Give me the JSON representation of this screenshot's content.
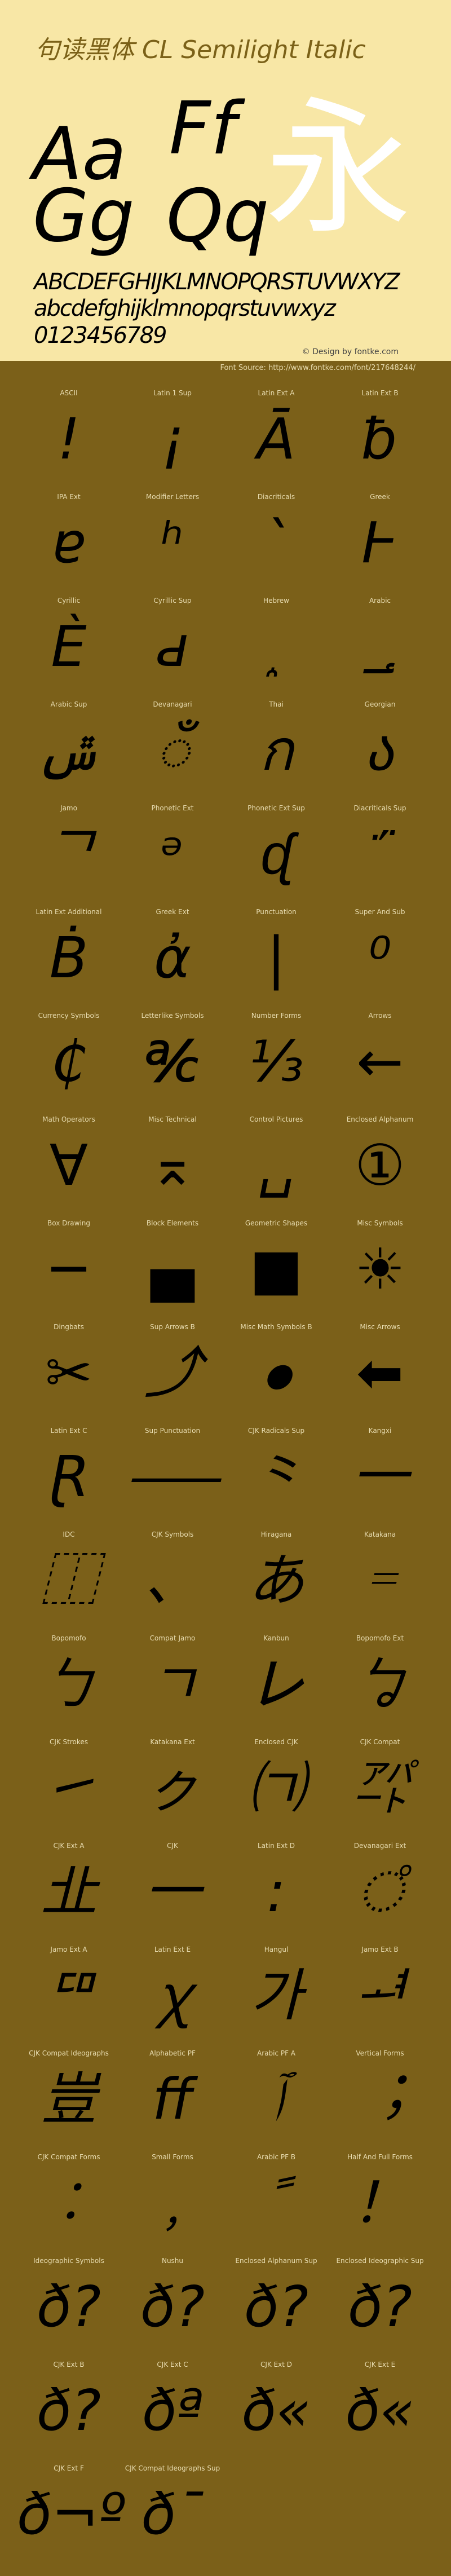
{
  "header": {
    "title": "句读黑体 CL Semilight Italic",
    "samples": [
      "Aa",
      "Ff",
      "Gg",
      "Qq"
    ],
    "hero": "永",
    "uppercase": "ABCDEFGHIJKLMNOPQRSTUVWXYZ",
    "lowercase": "abcdefghijklmnopqrstuvwxyz",
    "digits": "0123456789",
    "credit": "© Design by fontke.com",
    "source": "Font Source: http://www.fontke.com/font/217648244/"
  },
  "colors": {
    "header_bg": "#f8e7a6",
    "title": "#7b6118",
    "grid_bg": "#7b6019",
    "label": "#e8dcb0"
  },
  "blocks": [
    {
      "label": "ASCII",
      "glyph": "!"
    },
    {
      "label": "Latin 1 Sup",
      "glyph": "¡"
    },
    {
      "label": "Latin Ext A",
      "glyph": "Ā"
    },
    {
      "label": "Latin Ext B",
      "glyph": "ƀ"
    },
    {
      "label": "IPA Ext",
      "glyph": "ɐ"
    },
    {
      "label": "Modifier Letters",
      "glyph": "ʰ"
    },
    {
      "label": "Diacriticals",
      "glyph": "ˋ"
    },
    {
      "label": "Greek",
      "glyph": "Ͱ"
    },
    {
      "label": "Cyrillic",
      "glyph": "Ѐ"
    },
    {
      "label": "Cyrillic Sup",
      "glyph": "ԁ"
    },
    {
      "label": "Hebrew",
      "glyph": "֑"
    },
    {
      "label": "Arabic",
      "glyph": "؀"
    },
    {
      "label": "Arabic Sup",
      "glyph": "ݜ"
    },
    {
      "label": "Devanagari",
      "glyph": "ँ"
    },
    {
      "label": "Thai",
      "glyph": "ก"
    },
    {
      "label": "Georgian",
      "glyph": "ა"
    },
    {
      "label": "Jamo",
      "glyph": "ᄀ"
    },
    {
      "label": "Phonetic Ext",
      "glyph": "ᵊ"
    },
    {
      "label": "Phonetic Ext Sup",
      "glyph": "ᶑ"
    },
    {
      "label": "Diacriticals Sup",
      "glyph": "᷁"
    },
    {
      "label": "Latin Ext Additional",
      "glyph": "Ḃ"
    },
    {
      "label": "Greek Ext",
      "glyph": "ἀ"
    },
    {
      "label": "Punctuation",
      "glyph": "|"
    },
    {
      "label": "Super And Sub",
      "glyph": "⁰"
    },
    {
      "label": "Currency Symbols",
      "glyph": "₵"
    },
    {
      "label": "Letterlike Symbols",
      "glyph": "℀"
    },
    {
      "label": "Number Forms",
      "glyph": "⅓"
    },
    {
      "label": "Arrows",
      "glyph": "←"
    },
    {
      "label": "Math Operators",
      "glyph": "∀"
    },
    {
      "label": "Misc Technical",
      "glyph": "⌅"
    },
    {
      "label": "Control Pictures",
      "glyph": "␣"
    },
    {
      "label": "Enclosed Alphanum",
      "glyph": "①"
    },
    {
      "label": "Box Drawing",
      "glyph": "─"
    },
    {
      "label": "Block Elements",
      "glyph": "▄"
    },
    {
      "label": "Geometric Shapes",
      "glyph": "■"
    },
    {
      "label": "Misc Symbols",
      "glyph": "☀"
    },
    {
      "label": "Dingbats",
      "glyph": "✂"
    },
    {
      "label": "Sup Arrows B",
      "glyph": "⤴"
    },
    {
      "label": "Misc Math Symbols B",
      "glyph": "⦁"
    },
    {
      "label": "Misc Arrows",
      "glyph": "⬅"
    },
    {
      "label": "Latin Ext C",
      "glyph": "Ɽ"
    },
    {
      "label": "Sup Punctuation",
      "glyph": "⸺"
    },
    {
      "label": "CJK Radicals Sup",
      "glyph": "⺀"
    },
    {
      "label": "Kangxi",
      "glyph": "⼀"
    },
    {
      "label": "IDC",
      "glyph": "⿰"
    },
    {
      "label": "CJK Symbols",
      "glyph": "、"
    },
    {
      "label": "Hiragana",
      "glyph": "あ"
    },
    {
      "label": "Katakana",
      "glyph": "゠"
    },
    {
      "label": "Bopomofo",
      "glyph": "ㄅ"
    },
    {
      "label": "Compat Jamo",
      "glyph": "ㄱ"
    },
    {
      "label": "Kanbun",
      "glyph": "㆑"
    },
    {
      "label": "Bopomofo Ext",
      "glyph": "ㆠ"
    },
    {
      "label": "CJK Strokes",
      "glyph": "㇀"
    },
    {
      "label": "Katakana Ext",
      "glyph": "ㇰ"
    },
    {
      "label": "Enclosed CJK",
      "glyph": "㈀"
    },
    {
      "label": "CJK Compat",
      "glyph": "㌀"
    },
    {
      "label": "CJK Ext A",
      "glyph": "㐀"
    },
    {
      "label": "CJK",
      "glyph": "一"
    },
    {
      "label": "Latin Ext D",
      "glyph": "꞉"
    },
    {
      "label": "Devanagari Ext",
      "glyph": "꣠"
    },
    {
      "label": "Jamo Ext A",
      "glyph": "ꥠ"
    },
    {
      "label": "Latin Ext E",
      "glyph": "ꭓ"
    },
    {
      "label": "Hangul",
      "glyph": "가"
    },
    {
      "label": "Jamo Ext B",
      "glyph": "ힰ"
    },
    {
      "label": "CJK Compat Ideographs",
      "glyph": "豈"
    },
    {
      "label": "Alphabetic PF",
      "glyph": "ﬀ"
    },
    {
      "label": "Arabic PF A",
      "glyph": "ﭐ"
    },
    {
      "label": "Vertical Forms",
      "glyph": "︔"
    },
    {
      "label": "CJK Compat Forms",
      "glyph": "︰"
    },
    {
      "label": "Small Forms",
      "glyph": "﹐"
    },
    {
      "label": "Arabic PF B",
      "glyph": "ﹰ"
    },
    {
      "label": "Half And Full Forms",
      "glyph": "！"
    },
    {
      "label": "Ideographic Symbols",
      "glyph": "ð?"
    },
    {
      "label": "Nushu",
      "glyph": "ð?"
    },
    {
      "label": "Enclosed Alphanum Sup",
      "glyph": "ð?"
    },
    {
      "label": "Enclosed Ideographic Sup",
      "glyph": "ð?"
    },
    {
      "label": "CJK Ext B",
      "glyph": "ð?"
    },
    {
      "label": "CJK Ext C",
      "glyph": "ðª"
    },
    {
      "label": "CJK Ext D",
      "glyph": "ð«"
    },
    {
      "label": "CJK Ext E",
      "glyph": "ð«"
    },
    {
      "label": "CJK Ext F",
      "glyph": "ð¬º"
    },
    {
      "label": "CJK Compat Ideographs Sup",
      "glyph": "ð¯ "
    }
  ]
}
